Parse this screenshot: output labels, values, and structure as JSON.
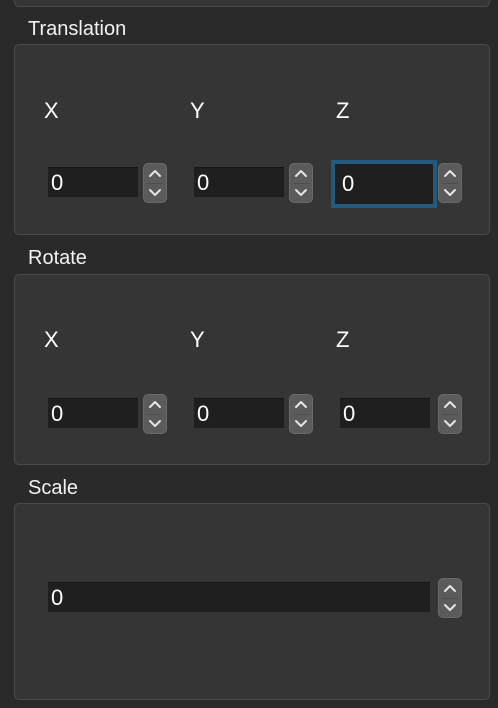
{
  "translation": {
    "title": "Translation",
    "axes": [
      {
        "label": "X",
        "value": "0"
      },
      {
        "label": "Y",
        "value": "0"
      },
      {
        "label": "Z",
        "value": "0"
      }
    ]
  },
  "rotate": {
    "title": "Rotate",
    "axes": [
      {
        "label": "X",
        "value": "0"
      },
      {
        "label": "Y",
        "value": "0"
      },
      {
        "label": "Z",
        "value": "0"
      }
    ]
  },
  "scale": {
    "title": "Scale",
    "value": "0"
  },
  "icons": {
    "increment": "chevron-up-icon",
    "decrement": "chevron-down-icon"
  },
  "colors": {
    "background": "#2a2a2a",
    "group_fill": "#353535",
    "field_fill": "#1f1f1f",
    "stepper_fill": "#5b5b5b",
    "focus_ring": "#24587c"
  }
}
